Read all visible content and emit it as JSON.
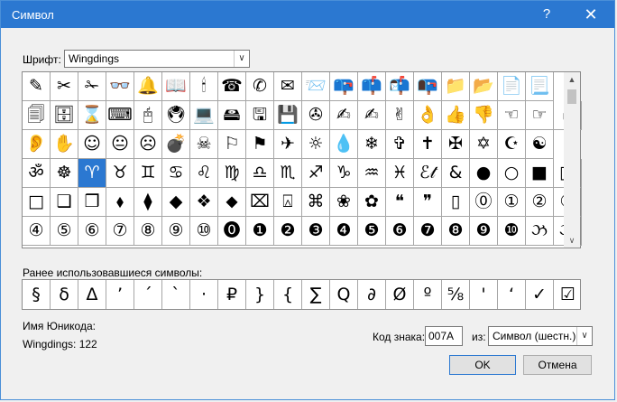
{
  "dialog": {
    "title": "Символ",
    "help": "?",
    "close": "✕"
  },
  "font": {
    "label": "Шрифт:",
    "value": "Wingdings"
  },
  "grid": {
    "selected_index": 60,
    "rows": [
      [
        "✎",
        "✂",
        "✁",
        "👓",
        "🔔",
        "📖",
        "🕯",
        "☎",
        "✆",
        "✉",
        "📨",
        "📪",
        "📫",
        "📬",
        "📭",
        "📁",
        "📂",
        "📄",
        "📃"
      ],
      [
        "🗐",
        "🗄",
        "⌛",
        "⌨",
        "🖰",
        "🖲",
        "💻",
        "🖴",
        "🖫",
        "💾",
        "✇",
        "✍",
        "✍",
        "✌",
        "👌",
        "👍",
        "👎",
        "☜",
        "☞",
        "☝"
      ],
      [
        "👂",
        "✋",
        "☺",
        "😐",
        "☹",
        "💣",
        "☠",
        "⚐",
        "⚑",
        "✈",
        "☼",
        "💧",
        "❄",
        "✞",
        "✝",
        "✠",
        "✡",
        "☪",
        "☯"
      ],
      [
        "ॐ",
        "☸",
        "♈",
        "♉",
        "♊",
        "♋",
        "♌",
        "♍",
        "♎",
        "♏",
        "♐",
        "♑",
        "♒",
        "♓",
        "ℰ𝓉",
        "&",
        "●",
        "○",
        "■",
        "□"
      ],
      [
        "□",
        "❑",
        "❒",
        "⬧",
        "⧫",
        "◆",
        "❖",
        "⬥",
        "⌧",
        "⍓",
        "⌘",
        "❀",
        "✿",
        "❝",
        "❞",
        "▯",
        "⓪",
        "①",
        "②",
        "③"
      ],
      [
        "④",
        "⑤",
        "⑥",
        "⑦",
        "⑧",
        "⑨",
        "⑩",
        "⓿",
        "❶",
        "❷",
        "❸",
        "❹",
        "❺",
        "❻",
        "❼",
        "❽",
        "❾",
        "❿",
        "ઝ",
        "ઝ"
      ]
    ]
  },
  "recent": {
    "label": "Ранее использовавшиеся символы:",
    "symbols": [
      "§",
      "δ",
      "Δ",
      "’",
      "´",
      "`",
      "·",
      "₽",
      "}",
      "{",
      "∑",
      "Ԛ",
      "∂",
      "Ø",
      "º",
      "⅝",
      "'",
      "‘",
      "✓",
      "☑"
    ]
  },
  "unicode": {
    "label": "Имя Юникода:",
    "value": "Wingdings: 122"
  },
  "code": {
    "label": "Код знака:",
    "value": "007A"
  },
  "from": {
    "label": "из:",
    "value": "Символ (шестн.)"
  },
  "buttons": {
    "ok": "OK",
    "cancel": "Отмена"
  }
}
